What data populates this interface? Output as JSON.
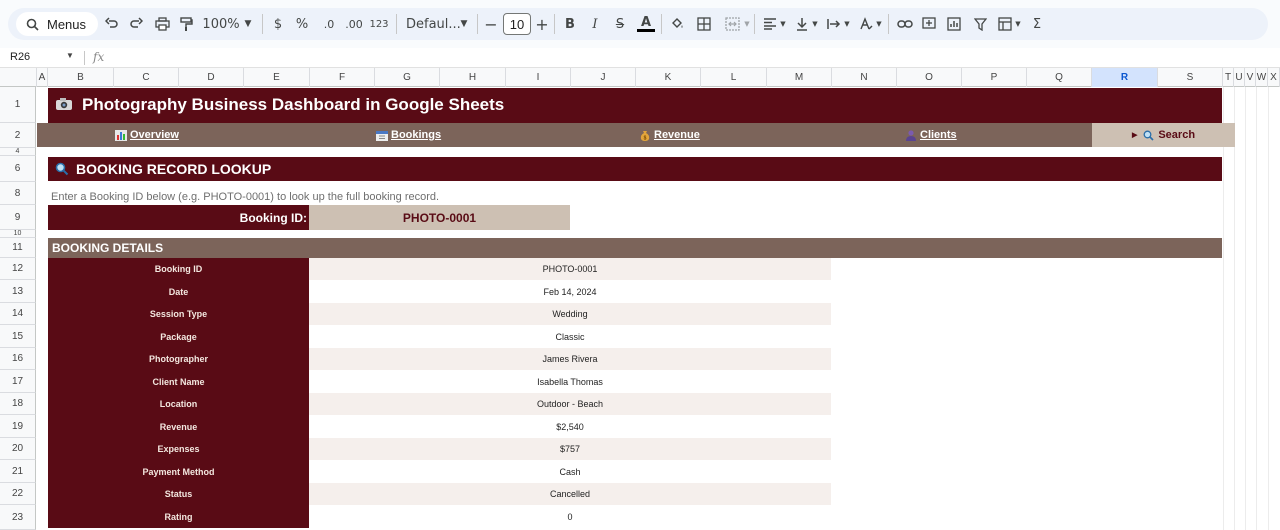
{
  "toolbar": {
    "menus_label": "Menus",
    "zoom": "100%",
    "currency": "$",
    "percent": "%",
    "decimal_decrease": ".0",
    "decimal_increase": ".00",
    "number_format": "123",
    "font_name": "Defaul...",
    "font_size": "10"
  },
  "formula_bar": {
    "cell_ref": "R26",
    "fx": "fx"
  },
  "columns": [
    "A",
    "B",
    "C",
    "D",
    "E",
    "F",
    "G",
    "H",
    "I",
    "J",
    "K",
    "L",
    "M",
    "N",
    "O",
    "P",
    "Q",
    "R",
    "S",
    "T",
    "U",
    "V",
    "W",
    "X"
  ],
  "selected_column": "R",
  "rows": [
    "1",
    "2",
    "4",
    "6",
    "8",
    "9",
    "10",
    "11",
    "12",
    "13",
    "14",
    "15",
    "16",
    "17",
    "18",
    "19",
    "20",
    "21",
    "22",
    "23"
  ],
  "banner": {
    "icon": "camera-icon",
    "title": "Photography Business Dashboard in Google Sheets"
  },
  "nav": {
    "overview": "Overview",
    "bookings": "Bookings",
    "revenue": "Revenue",
    "clients": "Clients",
    "search": "Search"
  },
  "lookup": {
    "section_title": "BOOKING RECORD LOOKUP",
    "instruction": "Enter a Booking ID below (e.g. PHOTO-0001) to look up the full booking record.",
    "id_label": "Booking ID:",
    "id_value": "PHOTO-0001"
  },
  "details": {
    "title": "BOOKING DETAILS",
    "rows": [
      {
        "label": "Booking ID",
        "value": "PHOTO-0001"
      },
      {
        "label": "Date",
        "value": "Feb 14, 2024"
      },
      {
        "label": "Session Type",
        "value": "Wedding"
      },
      {
        "label": "Package",
        "value": "Classic"
      },
      {
        "label": "Photographer",
        "value": "James Rivera"
      },
      {
        "label": "Client Name",
        "value": "Isabella Thomas"
      },
      {
        "label": "Location",
        "value": "Outdoor - Beach"
      },
      {
        "label": "Revenue",
        "value": "$2,540"
      },
      {
        "label": "Expenses",
        "value": "$757"
      },
      {
        "label": "Payment Method",
        "value": "Cash"
      },
      {
        "label": "Status",
        "value": "Cancelled"
      },
      {
        "label": "Rating",
        "value": "0"
      }
    ]
  },
  "colors": {
    "maroon": "#590b15",
    "taupe": "#7c645a",
    "sand": "#cdc0b3",
    "accent_blue": "#0b57d0"
  }
}
